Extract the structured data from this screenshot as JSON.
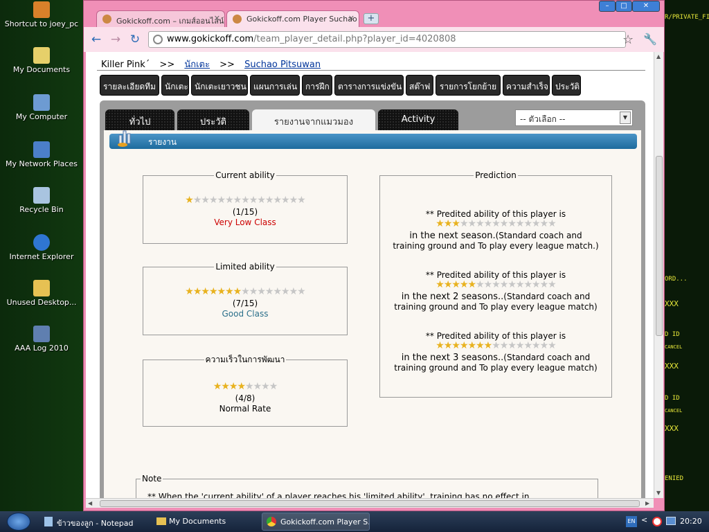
{
  "desktop": {
    "icons": [
      {
        "label": "Shortcut to joey_pc",
        "color": "#d9812a"
      },
      {
        "label": "My Documents",
        "color": "#e6d06a"
      },
      {
        "label": "My Computer",
        "color": "#6d9bd2"
      },
      {
        "label": "My Network Places",
        "color": "#4b7fc9"
      },
      {
        "label": "Recycle Bin",
        "color": "#a9c4e0"
      },
      {
        "label": "Internet Explorer",
        "color": "#2f76d2"
      },
      {
        "label": "Unused Desktop...",
        "color": "#e6c153"
      },
      {
        "label": "AAA Log 2010",
        "color": "#5f7fb0"
      }
    ],
    "right_deco": [
      "R/PRIVATE_FILES",
      "ORD...",
      "XXX",
      "D ID",
      "CANCEL",
      "XXX",
      "D ID",
      "CANCEL",
      "XXX",
      "ENIED"
    ]
  },
  "browser": {
    "tabs": [
      {
        "title": "Gokickoff.com – เกมส์ออนไลน์",
        "state": "inactive"
      },
      {
        "title": "Gokickoff.com Player Suchao P",
        "state": "active"
      }
    ],
    "new_tab": "+",
    "url_host": "www.gokickoff.com",
    "url_path": "/team_player_detail.php?player_id=4020808",
    "window_controls": [
      "–",
      "□",
      "✕"
    ]
  },
  "page": {
    "breadcrumb": {
      "team": "Killer Pink´",
      "sep": ">>",
      "players": "นักเตะ",
      "player": "Suchao Pitsuwan"
    },
    "menu": [
      "รายละเอียดทีม",
      "นักเตะ",
      "นักเตะเยาวชน",
      "แผนการเล่น",
      "การฝึก",
      "ตารางการแข่งขัน",
      "สต๊าฟ",
      "รายการโยกย้าย",
      "ความสำเร็จ",
      "ประวัติ"
    ],
    "panel_tabs": [
      "ทั่วไป",
      "ประวัติ",
      "รายงานจากแมวมอง",
      "Activity"
    ],
    "select_value": "-- ตัวเลือก --",
    "section_title": "รายงาน",
    "current": {
      "title": "Current ability",
      "stars": 1,
      "max": 15,
      "ratio": "(1/15)",
      "class": "Very Low Class",
      "class_color": "#cc0000"
    },
    "limited": {
      "title": "Limited ability",
      "stars": 7,
      "max": 15,
      "ratio": "(7/15)",
      "class": "Good Class",
      "class_color": "#2a6f8a"
    },
    "speed": {
      "title": "ความเร็วในการพัฒนา",
      "stars": 4,
      "max": 8,
      "ratio": "(4/8)",
      "class": "Normal Rate",
      "class_color": "#000000"
    },
    "prediction": {
      "title": "Prediction",
      "items": [
        {
          "head": "** Predited ability of this player is",
          "stars": 3,
          "max": 15,
          "season": "in the next season.",
          "rest": "(Standard coach and",
          "line2": "training ground and To play every league match.)"
        },
        {
          "head": "** Predited ability of this player is",
          "stars": 5,
          "max": 15,
          "season": "in the next 2 seasons..",
          "rest": "(Standard coach and",
          "line2": "training ground and To play every league match)"
        },
        {
          "head": "** Predited ability of this player is",
          "stars": 7,
          "max": 15,
          "season": "in the next 3 seasons..",
          "rest": "(Standard coach and",
          "line2": "training ground and To play every league match)"
        }
      ]
    },
    "note": {
      "title": "Note",
      "text": "** When the 'current ability' of a player reaches his 'limited ability', training has no effect in"
    }
  },
  "taskbar": {
    "items": [
      "ข้าวของลูก - Notepad",
      "My Documents",
      "Gokickoff.com Player S..."
    ],
    "lang": "EN",
    "time": "20:20"
  },
  "colors": {
    "browser_frame": "#f08fb7",
    "menu_bg": "#2a2a2a",
    "header_blue": "#1e6b9d",
    "star": "#e8b21f"
  }
}
